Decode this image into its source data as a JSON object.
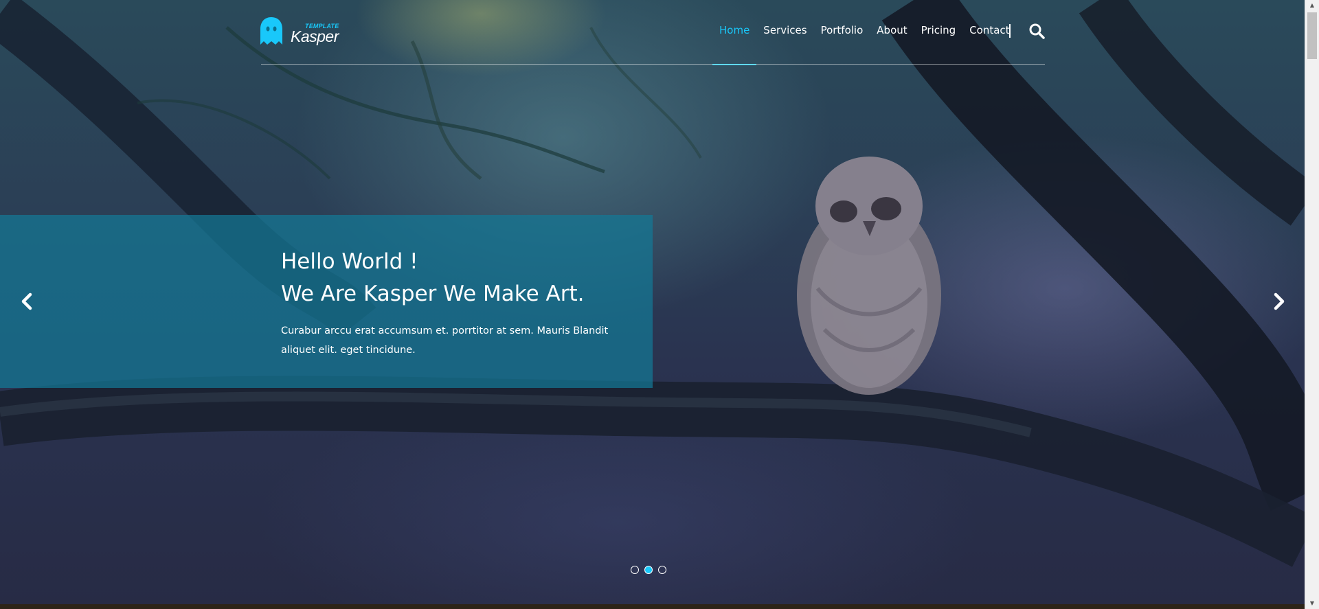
{
  "brand": {
    "template_label": "TEMPLATE",
    "name": "Kasper",
    "accent_color": "#19c8fa",
    "logo_icon": "ghost-icon"
  },
  "nav": {
    "items": [
      {
        "label": "Home",
        "active": true
      },
      {
        "label": "Services",
        "active": false
      },
      {
        "label": "Portfolio",
        "active": false
      },
      {
        "label": "About",
        "active": false
      },
      {
        "label": "Pricing",
        "active": false
      },
      {
        "label": "Contact",
        "active": false
      }
    ],
    "search_icon": "search-icon"
  },
  "slider": {
    "heading_line1": "Hello World !",
    "heading_line2": "We Are Kasper We Make Art.",
    "description": "Curabur arccu erat accumsum et. porrtitor at sem. Mauris Blandit aliquet elit. eget tincidune.",
    "prev_icon": "chevron-left-icon",
    "next_icon": "chevron-right-icon",
    "slide_count": 3,
    "active_slide": 2
  }
}
